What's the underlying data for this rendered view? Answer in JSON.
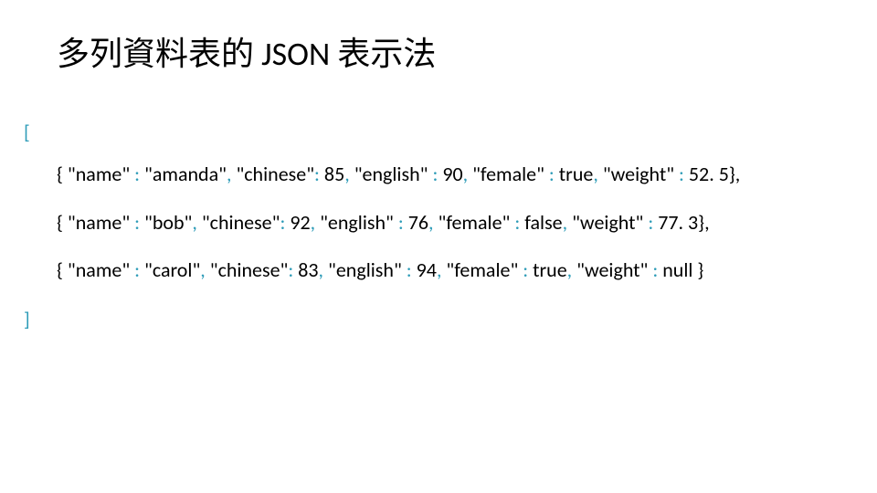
{
  "title": "多列資料表的 JSON 表示法",
  "bracket_open": "[",
  "bracket_close": "]",
  "records": [
    {
      "name_key": "\"name\"",
      "name_colon": " : ",
      "name_val": "\"amanda\"",
      "sep1": ", ",
      "chinese_key": "\"chinese\"",
      "chinese_colon": ": ",
      "chinese_val": "85",
      "sep2": ", ",
      "english_key": "\"english\"",
      "english_colon": " : ",
      "english_val": "90",
      "sep3": ", ",
      "female_key": "\"female\"",
      "female_colon": " : ",
      "female_val": "true",
      "sep4": ", ",
      "weight_key": "\"weight\"",
      "weight_colon": " : ",
      "weight_val": "52. 5",
      "close": "},"
    },
    {
      "name_key": "\"name\"",
      "name_colon": " : ",
      "name_val": "\"bob\"",
      "sep1": ", ",
      "chinese_key": "\"chinese\"",
      "chinese_colon": ": ",
      "chinese_val": "92",
      "sep2": ", ",
      "english_key": "\"english\"",
      "english_colon": " : ",
      "english_val": "76",
      "sep3": ", ",
      "female_key": "\"female\"",
      "female_colon": " : ",
      "female_val": "false",
      "sep4": ", ",
      "weight_key": "\"weight\"",
      "weight_colon": " : ",
      "weight_val": "77. 3",
      "close": "},"
    },
    {
      "name_key": "\"name\"",
      "name_colon": " : ",
      "name_val": "\"carol\"",
      "sep1": ", ",
      "chinese_key": "\"chinese\"",
      "chinese_colon": ": ",
      "chinese_val": "83",
      "sep2": ", ",
      "english_key": "\"english\"",
      "english_colon": " : ",
      "english_val": "94",
      "sep3": ", ",
      "female_key": "\"female\"",
      "female_colon": " : ",
      "female_val": "true",
      "sep4": ", ",
      "weight_key": "\"weight\"",
      "weight_colon": " : ",
      "weight_val": "null ",
      "close": "}"
    }
  ],
  "open_brace": "{ "
}
